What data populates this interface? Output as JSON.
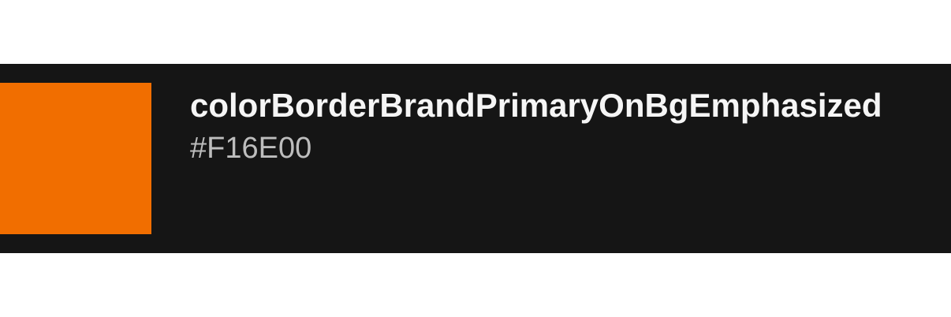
{
  "token": {
    "name": "colorBorderBrandPrimaryOnBgEmphasized",
    "value": "#F16E00",
    "swatch_color": "#F16E00"
  },
  "colors": {
    "card_background": "#151515",
    "name_text": "#F5F5F5",
    "value_text": "#BDBDBD",
    "page_background": "#FFFFFF"
  }
}
